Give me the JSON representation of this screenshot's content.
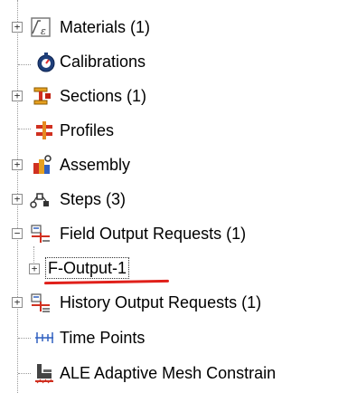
{
  "tree": {
    "items": [
      {
        "label": "Materials (1)",
        "icon": "materials-icon",
        "expander": "plus"
      },
      {
        "label": "Calibrations",
        "icon": "calibrations-icon",
        "expander": "none"
      },
      {
        "label": "Sections (1)",
        "icon": "sections-icon",
        "expander": "plus"
      },
      {
        "label": "Profiles",
        "icon": "profiles-icon",
        "expander": "none"
      },
      {
        "label": "Assembly",
        "icon": "assembly-icon",
        "expander": "plus"
      },
      {
        "label": "Steps (3)",
        "icon": "steps-icon",
        "expander": "plus"
      },
      {
        "label": "Field Output Requests (1)",
        "icon": "field-output-requests-icon",
        "expander": "minus"
      },
      {
        "label": "F-Output-1",
        "icon": "",
        "expander": "plus"
      },
      {
        "label": "History Output Requests (1)",
        "icon": "history-output-requests-icon",
        "expander": "plus"
      },
      {
        "label": "Time Points",
        "icon": "time-points-icon",
        "expander": "none"
      },
      {
        "label": "ALE Adaptive Mesh Constrain",
        "icon": "ale-adaptive-mesh-constraint-icon",
        "expander": "none"
      }
    ],
    "expander_symbols": {
      "plus": "+",
      "minus": "−"
    }
  },
  "colors": {
    "annotation_underline": "#e0201a",
    "guide": "#9a9a9a"
  }
}
